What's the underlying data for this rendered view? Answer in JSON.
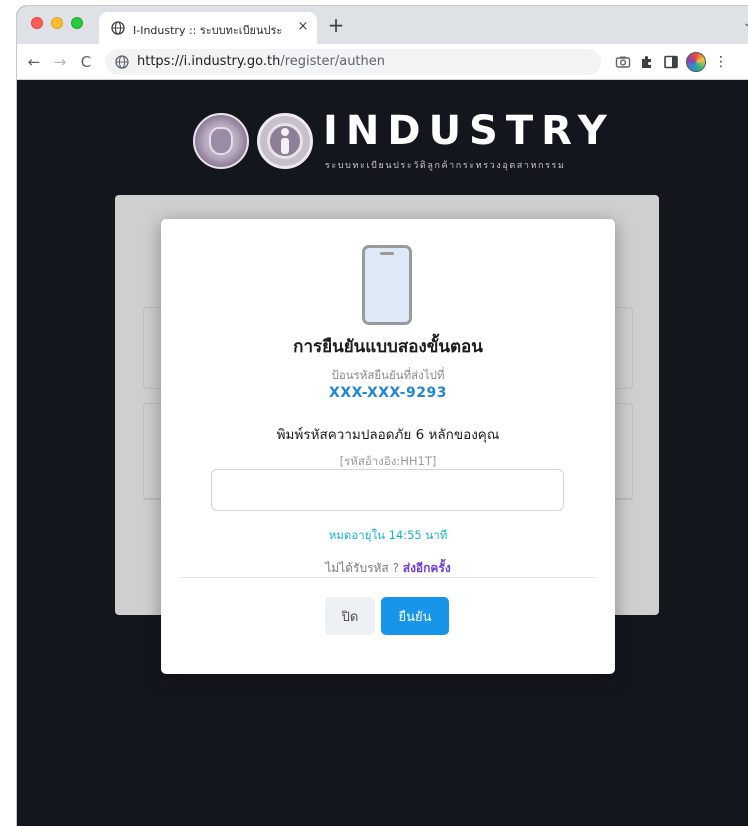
{
  "browser": {
    "tab": {
      "title": "I-Industry :: ระบบทะเบียนประวัติลู",
      "close": "×"
    },
    "new_tab": "+",
    "tab_menu": "⌄",
    "nav": {
      "back": "←",
      "forward": "→",
      "reload": "C"
    },
    "omnibox": {
      "host": "https://i.industry.go.th",
      "path": "/register/authen"
    },
    "kebab": "⋮"
  },
  "header": {
    "logo_word": "INDUSTRY",
    "logo_sub": "ระบบทะเบียนประวัติลูกค้ากระทรวงอุตสาหกรรม"
  },
  "modal": {
    "title": "การยืนยันแบบสองขั้นตอน",
    "subtitle": "ป้อนรหัสยืนยันที่ส่งไปที่",
    "phone": "XXX-XXX-9293",
    "prompt": "พิมพ์รหัสความปลอดภัย 6 หลักของคุณ",
    "reference": "[รหัสอ้างอิง:HH1T]",
    "otp_value": "",
    "expire": "หมดอายุใน 14:55 นาที",
    "resend_prefix": "ไม่ได้รับรหัส ? ",
    "resend_link": "ส่งอีกครั้ง",
    "close_label": "ปิด",
    "confirm_label": "ยืนยัน"
  },
  "colors": {
    "page_bg": "#13171d",
    "accent": "#1795e8",
    "phone_text": "#1f86d8",
    "expire_text": "#16b4c8",
    "resend_link": "#6f3cd6"
  }
}
